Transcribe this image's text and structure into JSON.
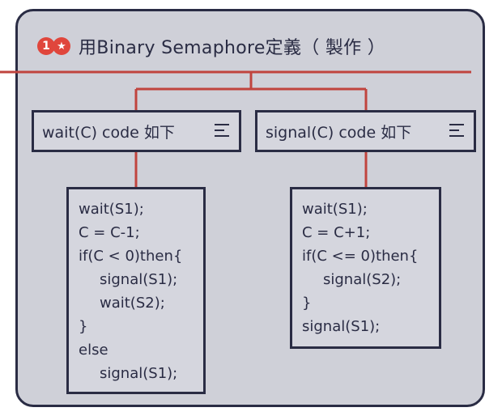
{
  "title": {
    "badge_number": "1",
    "badge_star": "★",
    "text": "用Binary Semaphore定義（ 製作 ）"
  },
  "colors": {
    "panel": "#cfd0d8",
    "border": "#2a2c44",
    "connector": "#c0443e",
    "badge": "#e0463c"
  },
  "left": {
    "header": "wait(C) code 如下",
    "lines": [
      "wait(S1);",
      "C = C-1;",
      "if(C < 0)then{",
      "signal(S1);",
      "wait(S2);",
      "}",
      "else",
      "signal(S1);"
    ]
  },
  "right": {
    "header": "signal(C) code 如下",
    "lines": [
      "wait(S1);",
      "C = C+1;",
      "if(C <= 0)then{",
      "signal(S2);",
      "}",
      "signal(S1);"
    ]
  }
}
